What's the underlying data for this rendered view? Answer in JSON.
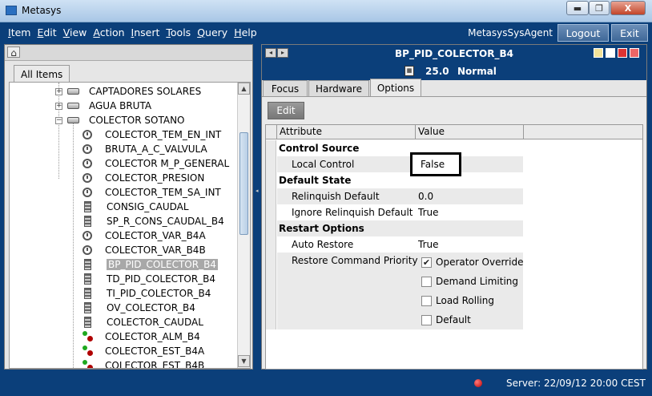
{
  "window": {
    "title": "Metasys",
    "controls": {
      "minimize": "▬",
      "maximize": "❐",
      "close": "X"
    }
  },
  "menubar": {
    "items": [
      "Item",
      "Edit",
      "View",
      "Action",
      "Insert",
      "Tools",
      "Query",
      "Help"
    ],
    "agent": "MetasysSysAgent",
    "logout_label": "Logout",
    "exit_label": "Exit"
  },
  "nav_panel": {
    "tab_label": "All Items",
    "tree": [
      {
        "label": "CAPTADORES SOLARES",
        "icon": "folder-icon",
        "expander": "+"
      },
      {
        "label": "AGUA BRUTA",
        "icon": "folder-icon",
        "expander": "+"
      },
      {
        "label": "COLECTOR SOTANO",
        "icon": "folder-icon",
        "expander": "−"
      },
      {
        "label": "COLECTOR_TEM_EN_INT",
        "icon": "gauge-icon"
      },
      {
        "label": "BRUTA_A_C_VALVULA",
        "icon": "gauge-icon"
      },
      {
        "label": "COLECTOR M_P_GENERAL",
        "icon": "gauge-icon"
      },
      {
        "label": "COLECTOR_PRESION",
        "icon": "gauge-icon"
      },
      {
        "label": "COLECTOR_TEM_SA_INT",
        "icon": "gauge-icon"
      },
      {
        "label": "CONSIG_CAUDAL",
        "icon": "bar-icon"
      },
      {
        "label": "SP_R_CONS_CAUDAL_B4",
        "icon": "bar-icon"
      },
      {
        "label": "COLECTOR_VAR_B4A",
        "icon": "gauge-icon"
      },
      {
        "label": "COLECTOR_VAR_B4B",
        "icon": "gauge-icon"
      },
      {
        "label": "BP_PID_COLECTOR_B4",
        "icon": "bar-icon",
        "selected": true
      },
      {
        "label": "TD_PID_COLECTOR_B4",
        "icon": "bar-icon"
      },
      {
        "label": "TI_PID_COLECTOR_B4",
        "icon": "bar-icon"
      },
      {
        "label": "OV_COLECTOR_B4",
        "icon": "bar-icon"
      },
      {
        "label": "COLECTOR_CAUDAL",
        "icon": "bar-icon"
      },
      {
        "label": "COLECTOR_ALM_B4",
        "icon": "status-dots-icon"
      },
      {
        "label": "COLECTOR_EST_B4A",
        "icon": "status-dots-icon"
      },
      {
        "label": "COLECTOR_EST_B4B",
        "icon": "status-dots-icon"
      }
    ]
  },
  "detail_panel": {
    "title": "BP_PID_COLECTOR_B4",
    "present_value": "25.0",
    "status": "Normal",
    "tabs": [
      "Focus",
      "Hardware",
      "Options"
    ],
    "active_tab": "Options",
    "edit_label": "Edit",
    "grid": {
      "headers": [
        "Attribute",
        "Value"
      ],
      "sections": [
        {
          "title": "Control Source",
          "rows": [
            {
              "attribute": "Local Control",
              "value": "False"
            }
          ]
        },
        {
          "title": "Default State",
          "rows": [
            {
              "attribute": "Relinquish Default",
              "value": "0.0"
            },
            {
              "attribute": "Ignore Relinquish Default",
              "value": "True"
            }
          ]
        },
        {
          "title": "Restart Options",
          "rows": [
            {
              "attribute": "Auto Restore",
              "value": "True"
            },
            {
              "attribute": "Restore Command Priority",
              "value": ""
            }
          ]
        }
      ],
      "priority_options": [
        {
          "label": "Operator Override",
          "checked": true
        },
        {
          "label": "Demand Limiting",
          "checked": false
        },
        {
          "label": "Load Rolling",
          "checked": false
        },
        {
          "label": "Default",
          "checked": false
        }
      ]
    }
  },
  "statusbar": {
    "server_text": "Server: 22/09/12 20:00 CEST",
    "alarm_color": "#c00000"
  },
  "colors": {
    "menubar_bg": "#0b3f7a",
    "panel_bg": "#e6e6e6"
  }
}
